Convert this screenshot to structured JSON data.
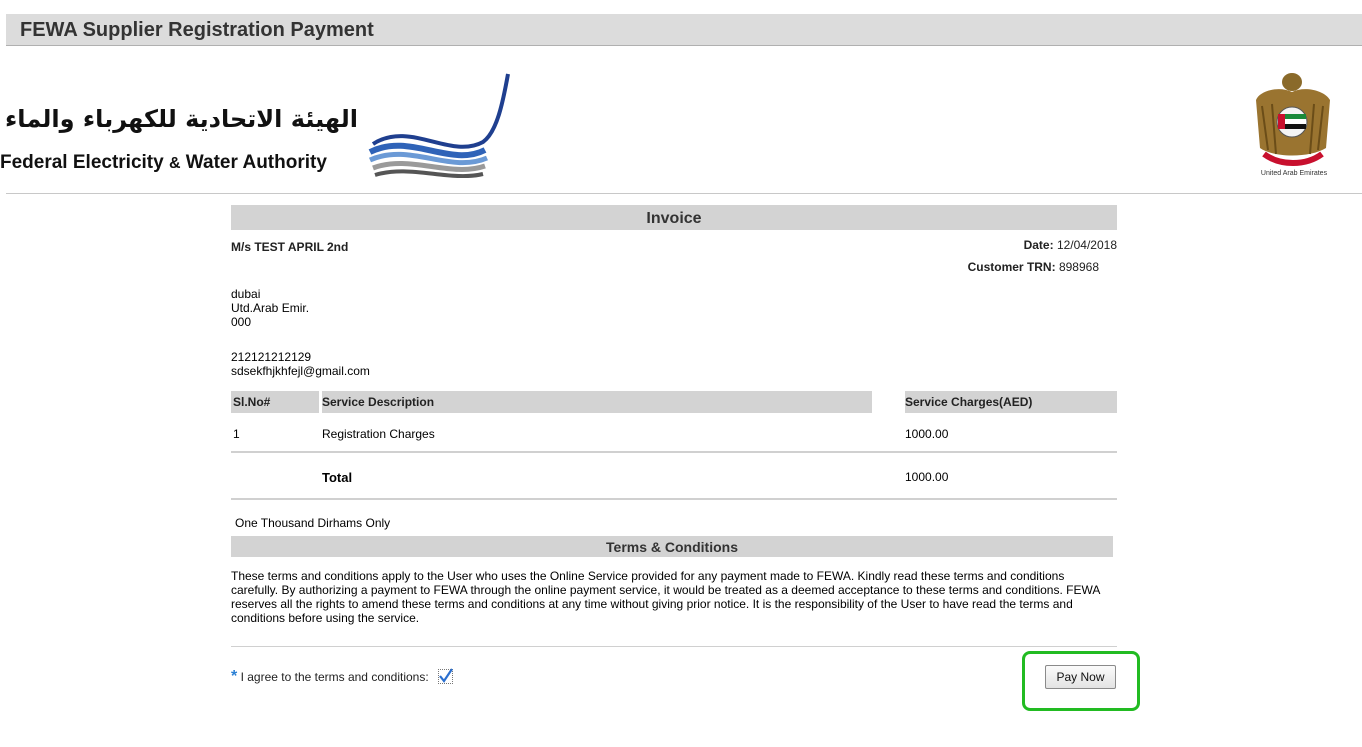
{
  "page": {
    "title": "FEWA Supplier Registration Payment"
  },
  "logo": {
    "arabic": "الهيئة الاتحادية للكهرباء والماء",
    "english_part1": "Federal Electricity ",
    "english_amp": "&",
    "english_part2": " Water Authority"
  },
  "emblem": {
    "caption": "United Arab Emirates"
  },
  "invoice": {
    "heading": "Invoice",
    "customer_name": "M/s TEST APRIL 2nd",
    "date_label": "Date:",
    "date_value": "12/04/2018",
    "trn_label": "Customer TRN:",
    "trn_value": "898968",
    "address": [
      "dubai",
      "Utd.Arab Emir.",
      "000"
    ],
    "phone": "212121212129",
    "email": "sdsekfhjkhfejl@gmail.com",
    "columns": [
      "Sl.No#",
      "Service Description",
      "Service Charges(AED)"
    ],
    "rows": [
      {
        "sl": "1",
        "description": "Registration Charges",
        "charges": "1000.00"
      }
    ],
    "total_label": "Total",
    "total_value": "1000.00",
    "amount_words": "One Thousand Dirhams Only"
  },
  "terms": {
    "heading": "Terms & Conditions",
    "text": "These terms and conditions apply to the User who uses the Online Service provided for any payment made to FEWA. Kindly read these terms and conditions carefully. By authorizing a payment to FEWA through the online payment service, it would be treated as a deemed acceptance to these terms and conditions. FEWA reserves all the rights to amend these terms and conditions at any time without giving prior notice. It is the responsibility of the User to have read the terms and conditions before using the service.",
    "required_mark": "*",
    "agree_label": "I agree to the terms and conditions:",
    "agree_checked": true
  },
  "actions": {
    "pay_label": "Pay Now"
  },
  "colors": {
    "header_bg": "#dcdcdc",
    "table_header_bg": "#d3d3d3",
    "highlight": "#22bb22",
    "required_star": "#2a7fd4"
  }
}
